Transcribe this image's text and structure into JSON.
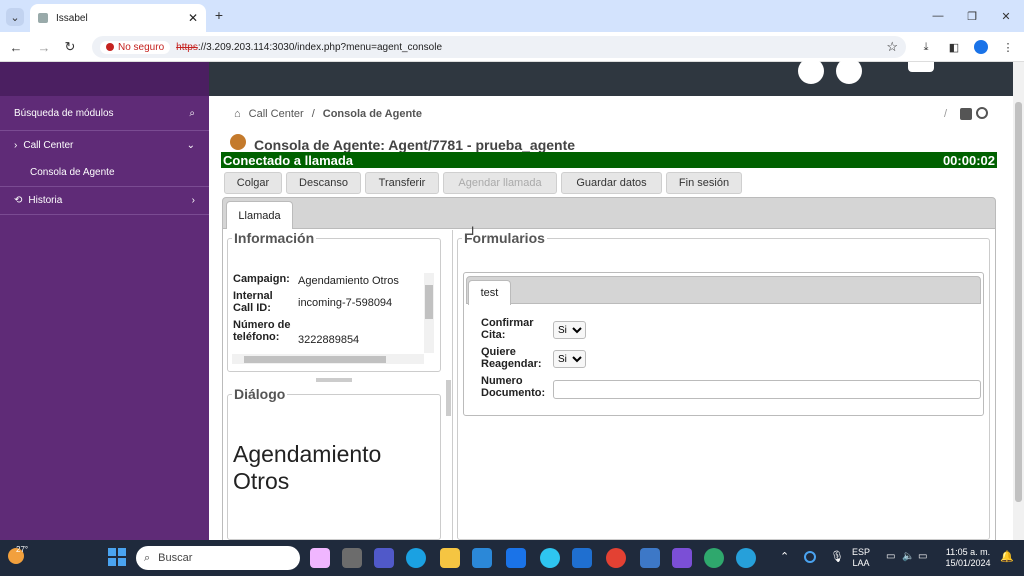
{
  "browser": {
    "tab_title": "Issabel",
    "security_label": "No seguro",
    "url_scheme": "https",
    "url_rest": "://3.209.203.114:3030/index.php?menu=agent_console"
  },
  "sidebar": {
    "search_label": "Búsqueda de módulos",
    "items": [
      {
        "label": "Call Center"
      },
      {
        "label": "Consola de Agente"
      },
      {
        "label": "Historia"
      }
    ]
  },
  "breadcrumb": {
    "items": [
      "Call Center",
      "Consola de Agente"
    ],
    "separator": "/"
  },
  "header": {
    "title": "Consola de Agente: Agent/7781 - prueba_agente",
    "status": "Conectado a llamada",
    "timer": "00:00:02"
  },
  "actions": [
    "Colgar",
    "Descanso",
    "Transferir",
    "Agendar llamada",
    "Guardar datos",
    "Fin sesión"
  ],
  "tabs": {
    "main": "Llamada",
    "form_tab": "test"
  },
  "informacion": {
    "legend": "Información",
    "rows": [
      {
        "label": "Campaign:",
        "value": "Agendamiento Otros"
      },
      {
        "label": "Internal Call ID:",
        "value": "incoming-7-598094"
      },
      {
        "label": "Número de teléfono:",
        "value": "3222889854"
      }
    ]
  },
  "dialogo": {
    "legend": "Diálogo",
    "text": "Agendamiento Otros"
  },
  "formularios": {
    "legend": "Formularios",
    "fields": [
      {
        "label": "Confirmar Cita:",
        "value": "Si"
      },
      {
        "label": "Quiere Reagendar:",
        "value": "Si"
      },
      {
        "label": "Numero Documento:",
        "value": ""
      }
    ]
  },
  "taskbar": {
    "weather": "27°",
    "search_placeholder": "Buscar",
    "lang": "ESP",
    "lang2": "LAA",
    "time": "11:05 a. m.",
    "date": "15/01/2024"
  },
  "colors": {
    "sidebar": "#5f2b77",
    "status_bar": "#006100",
    "app_header": "#2f3740"
  }
}
